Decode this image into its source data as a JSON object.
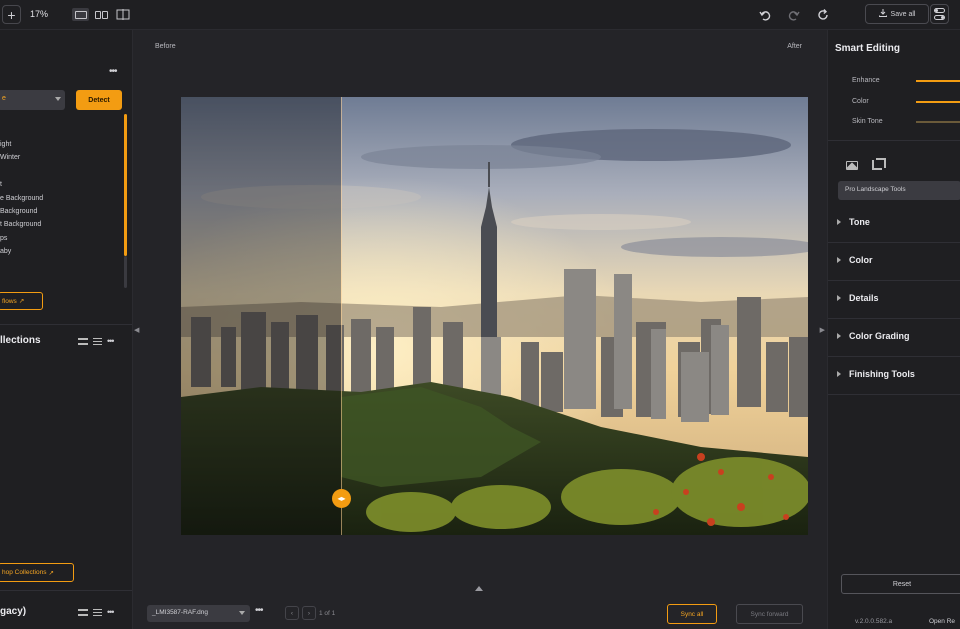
{
  "toolbar": {
    "zoom": "17%",
    "save_all": "Save all"
  },
  "left_panel": {
    "select_value": "e",
    "detect_label": "Detect",
    "items": [
      "ight",
      "Winter",
      "t",
      "e Background",
      "Background",
      "t Background",
      "ps",
      "aby"
    ],
    "workflows_label": "flows",
    "collections_heading": "llections",
    "shop_collections_label": "hop Collections",
    "legacy_heading": "gacy)"
  },
  "canvas": {
    "before_label": "Before",
    "after_label": "After"
  },
  "bottom_bar": {
    "file_name": "_LMI3587-RAF.dng",
    "page_info": "1 of 1",
    "sync_all": "Sync all",
    "sync_forward": "Sync forward"
  },
  "right_panel": {
    "title": "Smart Editing",
    "sliders": [
      {
        "label": "Enhance",
        "value": 0.7
      },
      {
        "label": "Color",
        "value": 0.7
      },
      {
        "label": "Skin Tone",
        "value": 0.5
      }
    ],
    "preset": "Pro Landscape Tools",
    "sections": [
      "Tone",
      "Color",
      "Details",
      "Color Grading",
      "Finishing Tools"
    ],
    "reset_label": "Reset",
    "version": "v.2.0.0.582.a",
    "open_label": "Open Re"
  },
  "colors": {
    "accent": "#f39c12",
    "background": "#1c1c1f",
    "panel": "#1f1f22",
    "canvas": "#242428"
  },
  "icons": [
    "plus-icon",
    "single-view-icon",
    "split-view-icon",
    "compare-view-icon",
    "undo-icon",
    "redo-icon",
    "reset-icon",
    "download-icon",
    "toggle-icon",
    "more-icon",
    "external-link-icon",
    "grid-view-icon",
    "list-view-icon",
    "image-icon",
    "crop-icon",
    "chevron-right-icon",
    "chevron-left-icon",
    "chevron-up-icon"
  ]
}
